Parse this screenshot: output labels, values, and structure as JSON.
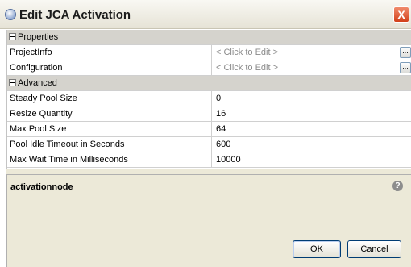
{
  "window": {
    "title": "Edit JCA Activation",
    "close_icon": "X"
  },
  "sheet": {
    "groups": [
      {
        "label": "Properties",
        "rows": [
          {
            "name": "ProjectInfo",
            "value": "< Click to Edit >",
            "editor_button": "..."
          },
          {
            "name": "Configuration",
            "value": "< Click to Edit >",
            "editor_button": "..."
          }
        ]
      },
      {
        "label": "Advanced",
        "rows": [
          {
            "name": "Steady Pool Size",
            "value": "0"
          },
          {
            "name": "Resize Quantity",
            "value": "16"
          },
          {
            "name": "Max Pool Size",
            "value": "64"
          },
          {
            "name": "Pool Idle Timeout in Seconds",
            "value": "600"
          },
          {
            "name": "Max Wait Time in Milliseconds",
            "value": "10000"
          }
        ]
      }
    ]
  },
  "description": {
    "title": "activationnode",
    "help_icon": "?"
  },
  "buttons": {
    "ok": "OK",
    "cancel": "Cancel"
  }
}
